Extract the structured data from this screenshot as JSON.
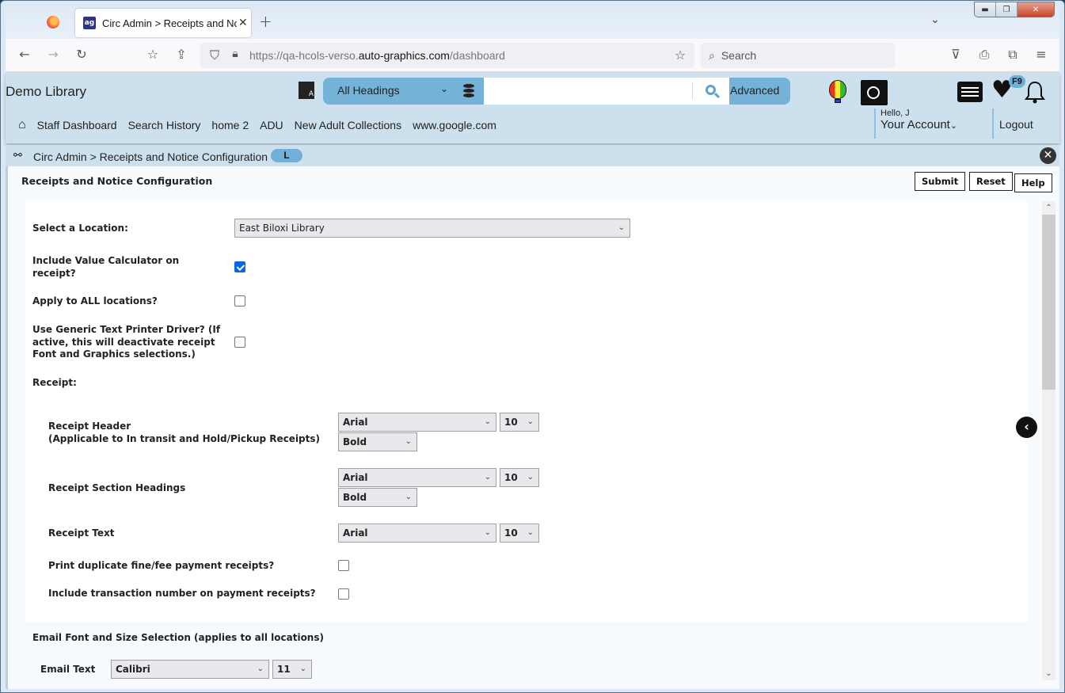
{
  "browser": {
    "tab_title": "Circ Admin > Receipts and Noti",
    "tab_close": "✕",
    "new_tab": "+",
    "url_prefix": "https://qa-hcols-verso.",
    "url_domain": "auto-graphics.com",
    "url_path": "/dashboard",
    "search_placeholder": "Search",
    "window_controls": {
      "minimize": "▬",
      "restore": "❐",
      "close": "✕"
    }
  },
  "header": {
    "library_name": "Demo Library",
    "search": {
      "scope": "All Headings",
      "query": "",
      "advanced_label": "Advanced"
    },
    "badge_f9": "F9",
    "nav_links": [
      "Staff Dashboard",
      "Search History",
      "home 2",
      "ADU",
      "New Adult Collections",
      "www.google.com"
    ],
    "account": {
      "greeting": "Hello, J",
      "label": "Your Account"
    },
    "logout_label": "Logout"
  },
  "breadcrumb": {
    "text": "Circ Admin > Receipts and Notice Configuration",
    "badge": "L"
  },
  "page": {
    "title": "Receipts and Notice Configuration",
    "buttons": {
      "submit": "Submit",
      "reset": "Reset",
      "help": "Help"
    },
    "location_label": "Select a Location:",
    "location_value": "East Biloxi Library",
    "include_value_calc_label": "Include Value Calculator on receipt?",
    "include_value_calc_checked": true,
    "apply_all_label": "Apply to ALL locations?",
    "apply_all_checked": false,
    "generic_driver_label": "Use Generic Text Printer Driver? (If active, this will deactivate receipt Font and Graphics selections.)",
    "generic_driver_checked": false,
    "receipt_section_label": "Receipt:",
    "receipt_rows": [
      {
        "label": "Receipt Header",
        "sublabel": "(Applicable to In transit and Hold/Pickup Receipts)",
        "font": "Arial",
        "size": "10",
        "style": "Bold"
      },
      {
        "label": "Receipt Section Headings",
        "sublabel": "",
        "font": "Arial",
        "size": "10",
        "style": "Bold"
      },
      {
        "label": "Receipt Text",
        "sublabel": "",
        "font": "Arial",
        "size": "10",
        "style": ""
      }
    ],
    "print_duplicate_label": "Print duplicate fine/fee payment receipts?",
    "print_duplicate_checked": false,
    "include_txn_label": "Include transaction number on payment receipts?",
    "include_txn_checked": false,
    "email_section_label": "Email Font and Size Selection (applies to all locations)",
    "email_text_label": "Email Text",
    "email_font": "Calibri",
    "email_size": "11"
  },
  "colors": {
    "header_bg": "#cde0ee",
    "search_accent": "#75b2d8",
    "checkbox_checked": "#0b66e4"
  }
}
